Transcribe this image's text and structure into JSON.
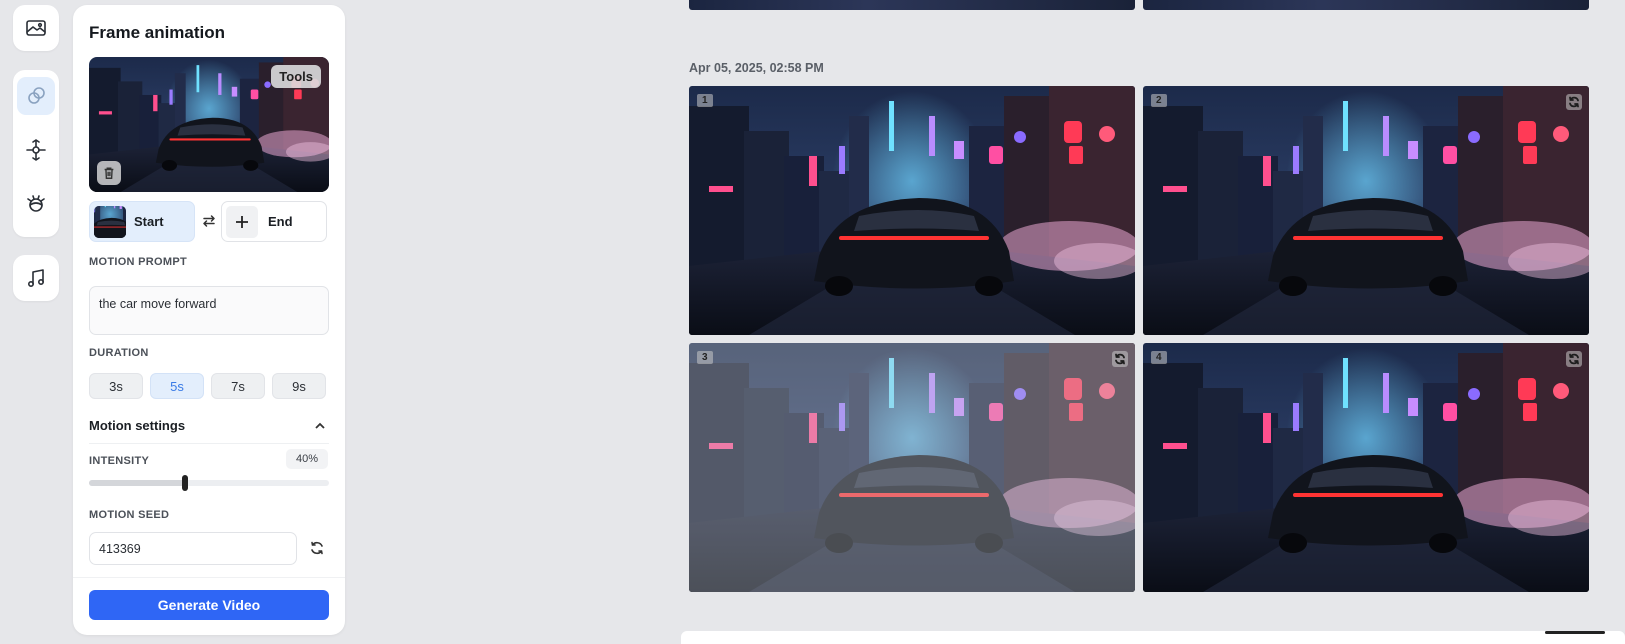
{
  "rail": {
    "items": [
      {
        "icon": "image-icon"
      },
      {
        "icon": "frames-icon",
        "active": true
      },
      {
        "icon": "motion-icon"
      },
      {
        "icon": "character-icon"
      },
      {
        "icon": "music-icon"
      }
    ]
  },
  "panel": {
    "title": "Frame animation",
    "tools_label": "Tools",
    "start_label": "Start",
    "end_label": "End",
    "motion_prompt_label": "MOTION PROMPT",
    "motion_prompt_value": "the car move forward",
    "duration_label": "DURATION",
    "durations": [
      "3s",
      "5s",
      "7s",
      "9s"
    ],
    "selected_duration": "5s",
    "motion_settings_label": "Motion settings",
    "intensity_label": "INTENSITY",
    "intensity_value": "40%",
    "intensity_fraction": 0.4,
    "motion_seed_label": "MOTION SEED",
    "motion_seed_value": "413369",
    "generate_label": "Generate Video"
  },
  "gallery": {
    "date": "Apr 05, 2025, 02:58 PM",
    "tiles": [
      {
        "number": "1",
        "regen": false
      },
      {
        "number": "2",
        "regen": true
      },
      {
        "number": "3",
        "regen": true
      },
      {
        "number": "4",
        "regen": true
      }
    ]
  },
  "colors": {
    "accent": "#2f66f5",
    "selected_bg": "#e3eefc",
    "background": "#e6e7ea"
  }
}
